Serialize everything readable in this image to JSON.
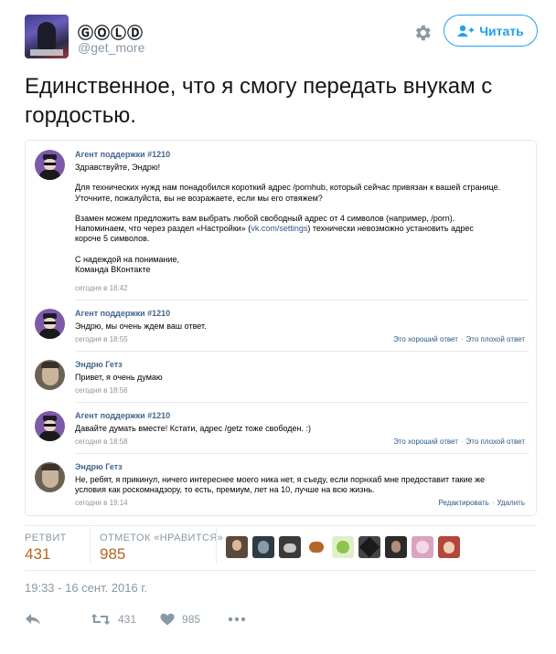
{
  "header": {
    "display_name": "ⒼⓄⓁⒹ",
    "handle": "@get_more",
    "follow_label": "Читать",
    "avatar_caption": "GETGOLD"
  },
  "tweet": {
    "text": "Единственное, что я смогу передать внукам с гордостью."
  },
  "conversation": {
    "messages": [
      {
        "author": "Агент поддержки #1210",
        "lines": [
          "Здравствуйте, Эндрю!",
          "",
          "Для технических нужд нам понадобился короткий адрес /pornhub, который сейчас привязан к вашей странице.",
          "Уточните, пожалуйста, вы не возражаете, если мы его отвяжем?",
          "",
          "Взамен можем предложить вам выбрать любой свободный адрес от 4 символов (например, /porn).",
          "",
          "технически невозможно установить адрес",
          "короче 5 символов.",
          "",
          "С надеждой на понимание,",
          "Команда ВКонтакте"
        ],
        "settings_line_start": "Напоминаем, что через раздел «Настройки» (",
        "settings_link": "vk.com/settings",
        "settings_line_end": ") технически невозможно установить адрес",
        "time": "сегодня в 18:42"
      },
      {
        "author": "Агент поддержки #1210",
        "text": "Эндрю, мы очень ждем ваш ответ.",
        "time": "сегодня в 18:55",
        "good": "Это хороший ответ",
        "bad": "Это плохой ответ"
      },
      {
        "author": "Эндрю Гетз",
        "text": "Привет, я очень думаю",
        "time": "сегодня в 18:56"
      },
      {
        "author": "Агент поддержки #1210",
        "text": "Давайте думать вместе! Кстати, адрес /getz тоже свободен. :)",
        "time": "сегодня в 18:58",
        "good": "Это хороший ответ",
        "bad": "Это плохой ответ"
      },
      {
        "author": "Эндрю Гетз",
        "text1": "Не, ребят, я прикинул, ничего интереснее моего ника нет, я съеду, если порнхаб мне предоставит такие же",
        "text2": "условия как роскомнадзору, то есть, премиум, лет на 10, лучше на всю жизнь.",
        "time": "сегодня в 19:14",
        "edit": "Редактировать",
        "delete": "Удалить"
      }
    ],
    "separator": "·"
  },
  "stats": {
    "retweets_label": "РЕТВИТ",
    "retweets_value": "431",
    "likes_label": "ОТМЕТОК «НРАВИТСЯ»",
    "likes_value": "985"
  },
  "timestamp": "19:33 - 16 сент. 2016 г.",
  "actions": {
    "retweet_count": "431",
    "like_count": "985"
  },
  "likers": [
    {
      "icon": "liker-avatar-1",
      "color": "#5b4a3a"
    },
    {
      "icon": "liker-avatar-2",
      "color": "#2f3b44"
    },
    {
      "icon": "liker-avatar-3",
      "color": "#3a3a3a"
    },
    {
      "icon": "liker-avatar-4",
      "color": "#b5652a"
    },
    {
      "icon": "liker-avatar-5",
      "color": "#8fc44a"
    },
    {
      "icon": "liker-avatar-6",
      "color": "#444444"
    },
    {
      "icon": "liker-avatar-7",
      "color": "#2b2b2b"
    },
    {
      "icon": "liker-avatar-8",
      "color": "#d9a3c2"
    },
    {
      "icon": "liker-avatar-9",
      "color": "#b4473d"
    }
  ],
  "colors": {
    "twitter_blue": "#1da1f2",
    "vk_name": "#42648b",
    "vk_link": "#2a5885",
    "stat_value": "#b5651d"
  }
}
